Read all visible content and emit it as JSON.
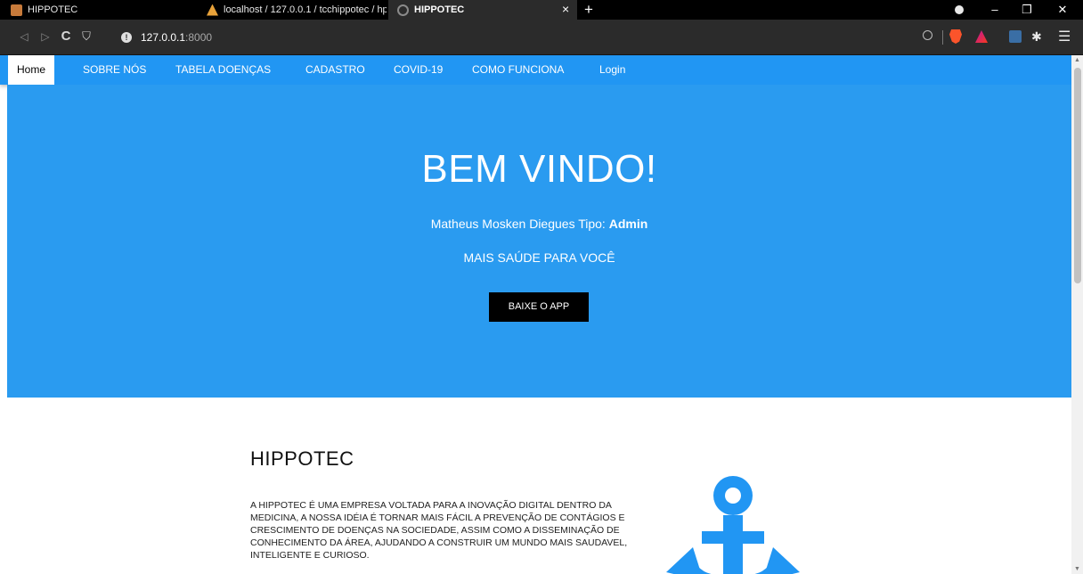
{
  "browser": {
    "tabs": [
      {
        "title": "HIPPOTEC",
        "active": false
      },
      {
        "title": "localhost / 127.0.0.1 / tcchippotec / hp",
        "active": false
      },
      {
        "title": "HIPPOTEC",
        "active": true
      }
    ],
    "close_glyph": "×",
    "new_tab_glyph": "+",
    "window_controls": {
      "minimize": "–",
      "restore": "❐",
      "close": "✕"
    },
    "nav": {
      "back": "◁",
      "forward": "▷",
      "reload": "C",
      "bookmark": "⛉"
    },
    "url_host": "127.0.0.1",
    "url_port": ":8000",
    "icons": [
      "info-icon",
      "zoom-icon",
      "brave-shield-icon",
      "brave-rewards-icon",
      "extension-icon",
      "puzzle-icon",
      "menu-icon"
    ],
    "menu_glyph": "☰",
    "puzzle_glyph": "✱"
  },
  "nav": {
    "items": [
      {
        "label": "Home",
        "active": true
      },
      {
        "label": "SOBRE NÓS"
      },
      {
        "label": "TABELA DOENÇAS"
      },
      {
        "label": "CADASTRO"
      },
      {
        "label": "COVID-19"
      },
      {
        "label": "COMO FUNCIONA"
      },
      {
        "label": "Login"
      }
    ]
  },
  "hero": {
    "title": "BEM VINDO!",
    "user_text": "Matheus Mosken Diegues Tipo: ",
    "user_type": "Admin",
    "slogan": "MAIS SAÚDE PARA VOCÊ",
    "button": "BAIXE O APP"
  },
  "about": {
    "title": "HIPPOTEC",
    "text": "A HIPPOTEC É UMA EMPRESA VOLTADA PARA A INOVAÇÃO DIGITAL DENTRO DA MEDICINA, A NOSSA IDÉIA É TORNAR MAIS FÁCIL A PREVENÇÃO DE CONTÁGIOS E CRESCIMENTO DE DOENÇAS NA SOCIEDADE, ASSIM COMO A DISSEMINAÇÃO DE CONHECIMENTO DA ÁREA, AJUDANDO A CONSTRUIR UM MUNDO MAIS SAUDAVEL, INTELIGENTE E CURIOSO."
  },
  "colors": {
    "nav_bg": "#2196f3",
    "hero_bg": "#2a9bf0",
    "button_bg": "#000000",
    "anchor": "#2196f3"
  }
}
